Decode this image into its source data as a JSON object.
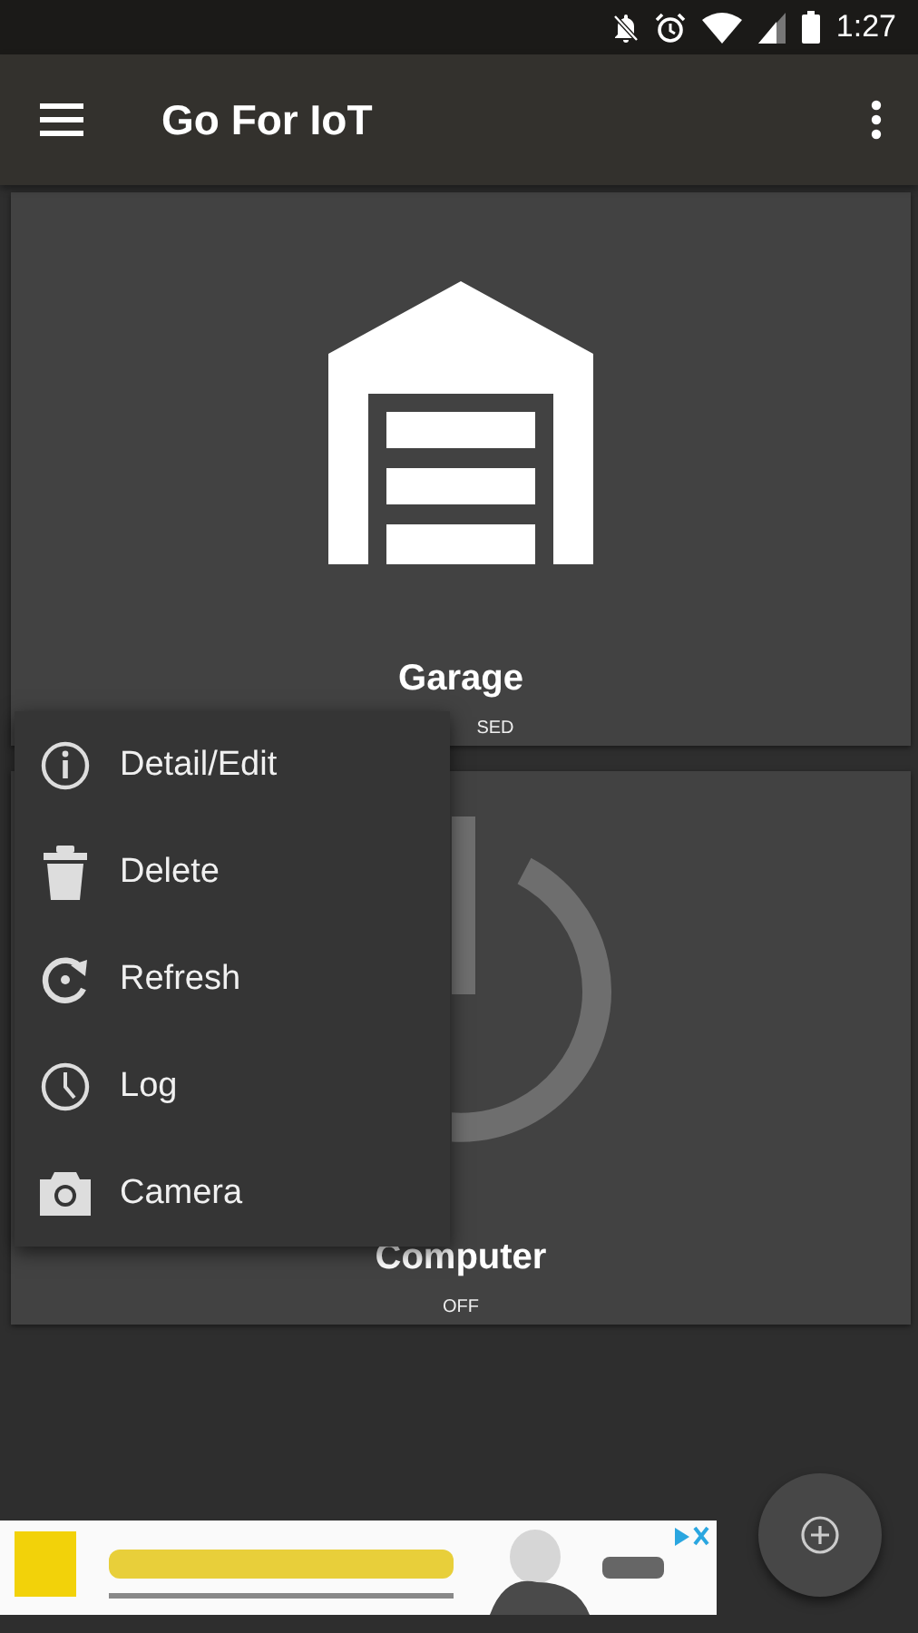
{
  "status_bar": {
    "time": "1:27"
  },
  "app_bar": {
    "title": "Go For IoT"
  },
  "devices": [
    {
      "kind": "garage",
      "name": "Garage",
      "status": "SED"
    },
    {
      "kind": "power",
      "name": "Computer",
      "status": "OFF"
    }
  ],
  "context_menu": {
    "items": [
      {
        "kind": "info",
        "label": "Detail/Edit"
      },
      {
        "kind": "delete",
        "label": "Delete"
      },
      {
        "kind": "refresh",
        "label": "Refresh"
      },
      {
        "kind": "log",
        "label": "Log"
      },
      {
        "kind": "camera",
        "label": "Camera"
      }
    ]
  }
}
